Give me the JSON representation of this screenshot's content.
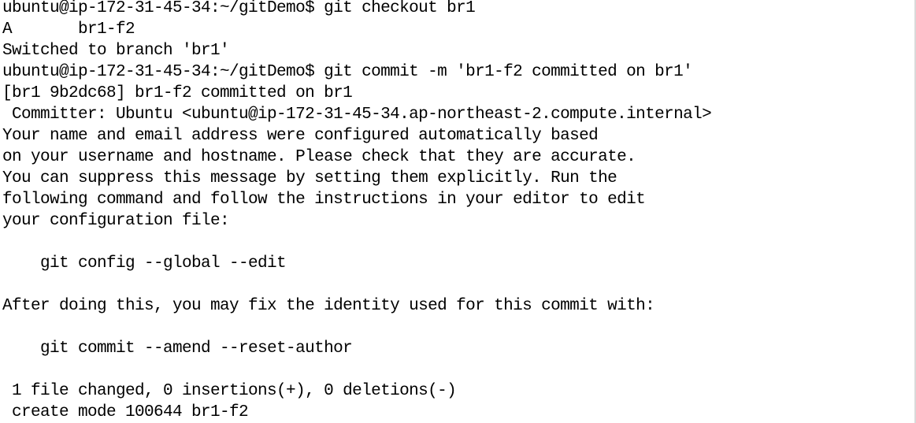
{
  "terminal": {
    "lines": [
      "ubuntu@ip-172-31-45-34:~/gitDemo$ git checkout br1",
      "A       br1-f2",
      "Switched to branch 'br1'",
      "ubuntu@ip-172-31-45-34:~/gitDemo$ git commit -m 'br1-f2 committed on br1'",
      "[br1 9b2dc68] br1-f2 committed on br1",
      " Committer: Ubuntu <ubuntu@ip-172-31-45-34.ap-northeast-2.compute.internal>",
      "Your name and email address were configured automatically based",
      "on your username and hostname. Please check that they are accurate.",
      "You can suppress this message by setting them explicitly. Run the",
      "following command and follow the instructions in your editor to edit",
      "your configuration file:",
      "",
      "    git config --global --edit",
      "",
      "After doing this, you may fix the identity used for this commit with:",
      "",
      "    git commit --amend --reset-author",
      "",
      " 1 file changed, 0 insertions(+), 0 deletions(-)",
      " create mode 100644 br1-f2"
    ]
  }
}
